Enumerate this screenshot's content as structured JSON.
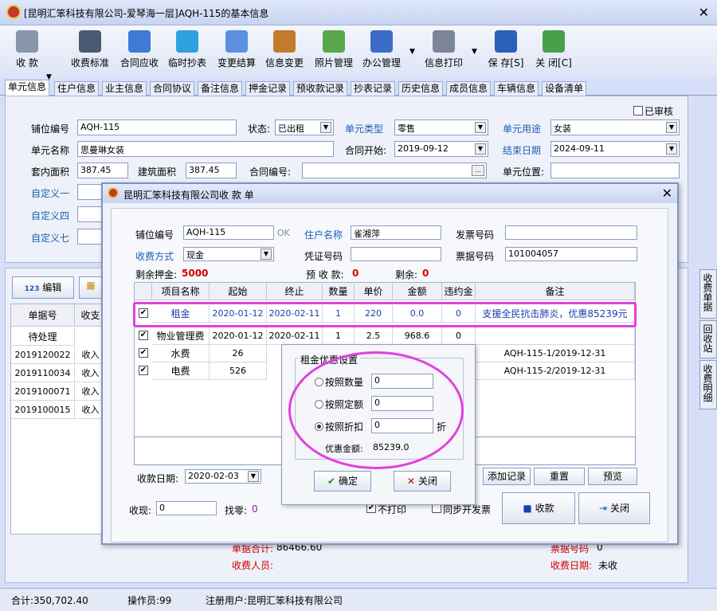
{
  "window": {
    "title": "[昆明汇笨科技有限公司-爱琴海一层]AQH-115的基本信息"
  },
  "toolbar": [
    {
      "id": "collect",
      "label": "收  款"
    },
    {
      "id": "fee-std",
      "label": "收费标准"
    },
    {
      "id": "contract-due",
      "label": "合同应收"
    },
    {
      "id": "temp-meter",
      "label": "临时抄表"
    },
    {
      "id": "change-settle",
      "label": "变更结算"
    },
    {
      "id": "info-change",
      "label": "信息变更"
    },
    {
      "id": "photo-mgr",
      "label": "照片管理"
    },
    {
      "id": "office-mgr",
      "label": "办公管理"
    },
    {
      "id": "print-info",
      "label": "信息打印"
    },
    {
      "id": "save",
      "label": "保 存[S]"
    },
    {
      "id": "close",
      "label": "关 闭[C]"
    }
  ],
  "tabs": [
    "单元信息",
    "住户信息",
    "业主信息",
    "合同协议",
    "备注信息",
    "押金记录",
    "预收款记录",
    "抄表记录",
    "历史信息",
    "成员信息",
    "车辆信息",
    "设备清单"
  ],
  "unit": {
    "reviewed_label": "已审核",
    "code_label": "铺位编号",
    "code": "AQH-115",
    "status_label": "状态:",
    "status": "已出租",
    "type_label": "单元类型",
    "type": "零售",
    "use_label": "单元用途",
    "use": "女装",
    "name_label": "单元名称",
    "name": "思曼琳女装",
    "start_label": "合同开始:",
    "start": "2019-09-12",
    "end_label": "结束日期",
    "end": "2024-09-11",
    "inner_area_label": "套内面积",
    "inner_area": "387.45",
    "build_area_label": "建筑面积",
    "build_area": "387.45",
    "contract_no_label": "合同编号:",
    "pos_label": "单元位置:",
    "custom1": "自定义一",
    "custom4": "自定义四",
    "custom7": "自定义七"
  },
  "lower": {
    "edit_label": "编辑",
    "col1": "单据号",
    "col2": "收支",
    "rows": [
      {
        "no": "待处理",
        "t": ""
      },
      {
        "no": "2019120022",
        "t": "收入"
      },
      {
        "no": "2019110034",
        "t": "收入"
      },
      {
        "no": "2019100071",
        "t": "收入"
      },
      {
        "no": "2019100015",
        "t": "收入"
      }
    ],
    "total_label": "单据合计:",
    "total": "86466.60",
    "collector_label": "收费人员:",
    "receipt_label": "票据号码",
    "receipt": "0",
    "date_label": "收费日期:",
    "date": "未收",
    "side_tabs": [
      "收费单据",
      "回收站",
      "收费明细"
    ]
  },
  "status": {
    "total": "合计:350,702.40",
    "operator": "操作员:99",
    "user": "注册用户:昆明汇笨科技有限公司"
  },
  "dialog": {
    "title": "昆明汇笨科技有限公司收  款  单",
    "code_label": "铺位编号",
    "code": "AQH-115",
    "ok": "OK",
    "tenant_label": "住户名称",
    "tenant": "雀湘萍",
    "invoice_label": "发票号码",
    "method_label": "收费方式",
    "method": "现金",
    "voucher_label": "凭证号码",
    "ticket_label": "票据号码",
    "ticket": "101004057",
    "deposit_label": "剩余押金:",
    "deposit": "5000",
    "prepaid_label": "预 收 款:",
    "prepaid": "0",
    "remain_label": "剩余:",
    "remain": "0",
    "headers": [
      "项目名称",
      "起始",
      "终止",
      "数量",
      "单价",
      "金额",
      "违约金",
      "备注"
    ],
    "rows": [
      {
        "name": "租金",
        "start": "2020-01-12",
        "end": "2020-02-11",
        "qty": "1",
        "price": "220",
        "amount": "0.0",
        "fine": "0",
        "note": "支援全民抗击肺炎，优惠85239元"
      },
      {
        "name": "物业管理费",
        "start": "2020-01-12",
        "end": "2020-02-11",
        "qty": "1",
        "price": "2.5",
        "amount": "968.6",
        "fine": "0",
        "note": ""
      },
      {
        "name": "水费",
        "start": "26",
        "end": "",
        "qty": "",
        "price": "",
        "amount": "",
        "fine": "",
        "note": "AQH-115-1/2019-12-31"
      },
      {
        "name": "电费",
        "start": "526",
        "end": "",
        "qty": "",
        "price": "",
        "amount": "",
        "fine": "",
        "note": "AQH-115-2/2019-12-31"
      }
    ],
    "recv_date_label": "收款日期:",
    "recv_date": "2020-02-03",
    "add_btn": "添加记录",
    "reset_btn": "重置",
    "preview_btn": "预览",
    "cash_label": "收现:",
    "cash": "0",
    "change_label": "找零:",
    "change": "0",
    "noprint_label": "不打印",
    "sync_label": "同步开发票",
    "collect_btn": "收款",
    "close_btn": "关闭"
  },
  "popup": {
    "title": "租金优惠设置",
    "by_qty": "按照数量",
    "qty": "0",
    "by_amount": "按照定额",
    "amount": "0",
    "by_discount": "按照折扣",
    "discount": "0",
    "unit": "折",
    "total_label": "优惠金额:",
    "total": "85239.0",
    "ok_btn": "确定",
    "close_btn": "关闭"
  },
  "colors": {
    "highlight": "#e040e0",
    "blue": "#1a5fb4",
    "red": "#d00000"
  }
}
